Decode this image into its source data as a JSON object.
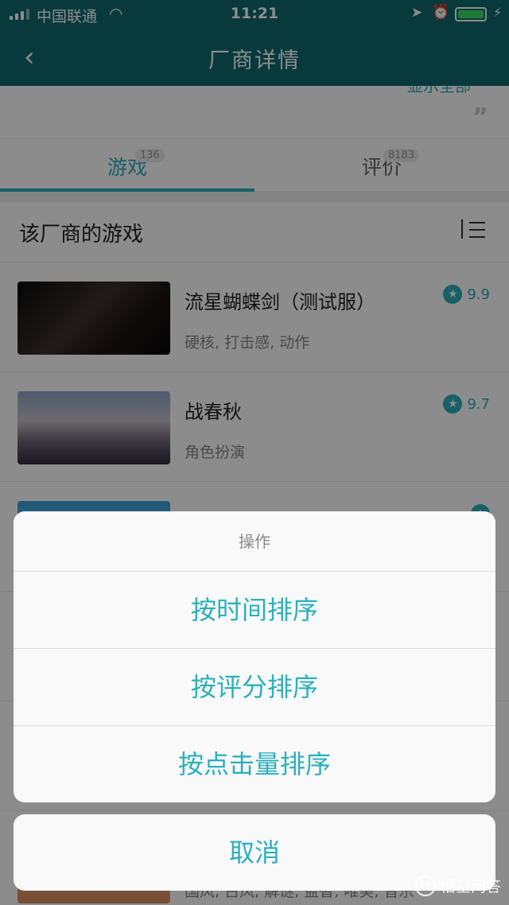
{
  "status_bar": {
    "carrier": "中国联通",
    "time": "11:21",
    "icons": [
      "signal-icon",
      "wifi-icon",
      "location-icon",
      "alarm-icon",
      "battery-icon",
      "charging-icon"
    ]
  },
  "nav": {
    "title": "厂商详情",
    "back_icon": "chevron-left-icon"
  },
  "intro": {
    "more_label": "显示全部"
  },
  "tabs": [
    {
      "label": "游戏",
      "count": "136",
      "active": true
    },
    {
      "label": "评价",
      "count": "8183",
      "active": false
    }
  ],
  "section": {
    "title": "该厂商的游戏",
    "sort_icon": "sort-icon"
  },
  "games": [
    {
      "name": "流星蝴蝶剑（测试服）",
      "tags": "硬核, 打击感, 动作",
      "score": "9.9"
    },
    {
      "name": "战春秋",
      "tags": "角色扮演",
      "score": "9.7"
    },
    {
      "name": "",
      "tags": "",
      "score": ""
    },
    {
      "name": "",
      "tags": "",
      "score": ""
    }
  ],
  "partial_bottom_tags": "国风, 古风, 解谜, 益智, 唯美, 音乐",
  "action_sheet": {
    "title": "操作",
    "options": [
      "按时间排序",
      "按评分排序",
      "按点击量排序"
    ],
    "cancel": "取消"
  },
  "watermark": "悟空问答",
  "colors": {
    "header": "#0f6a70",
    "accent": "#2bb0bd"
  }
}
